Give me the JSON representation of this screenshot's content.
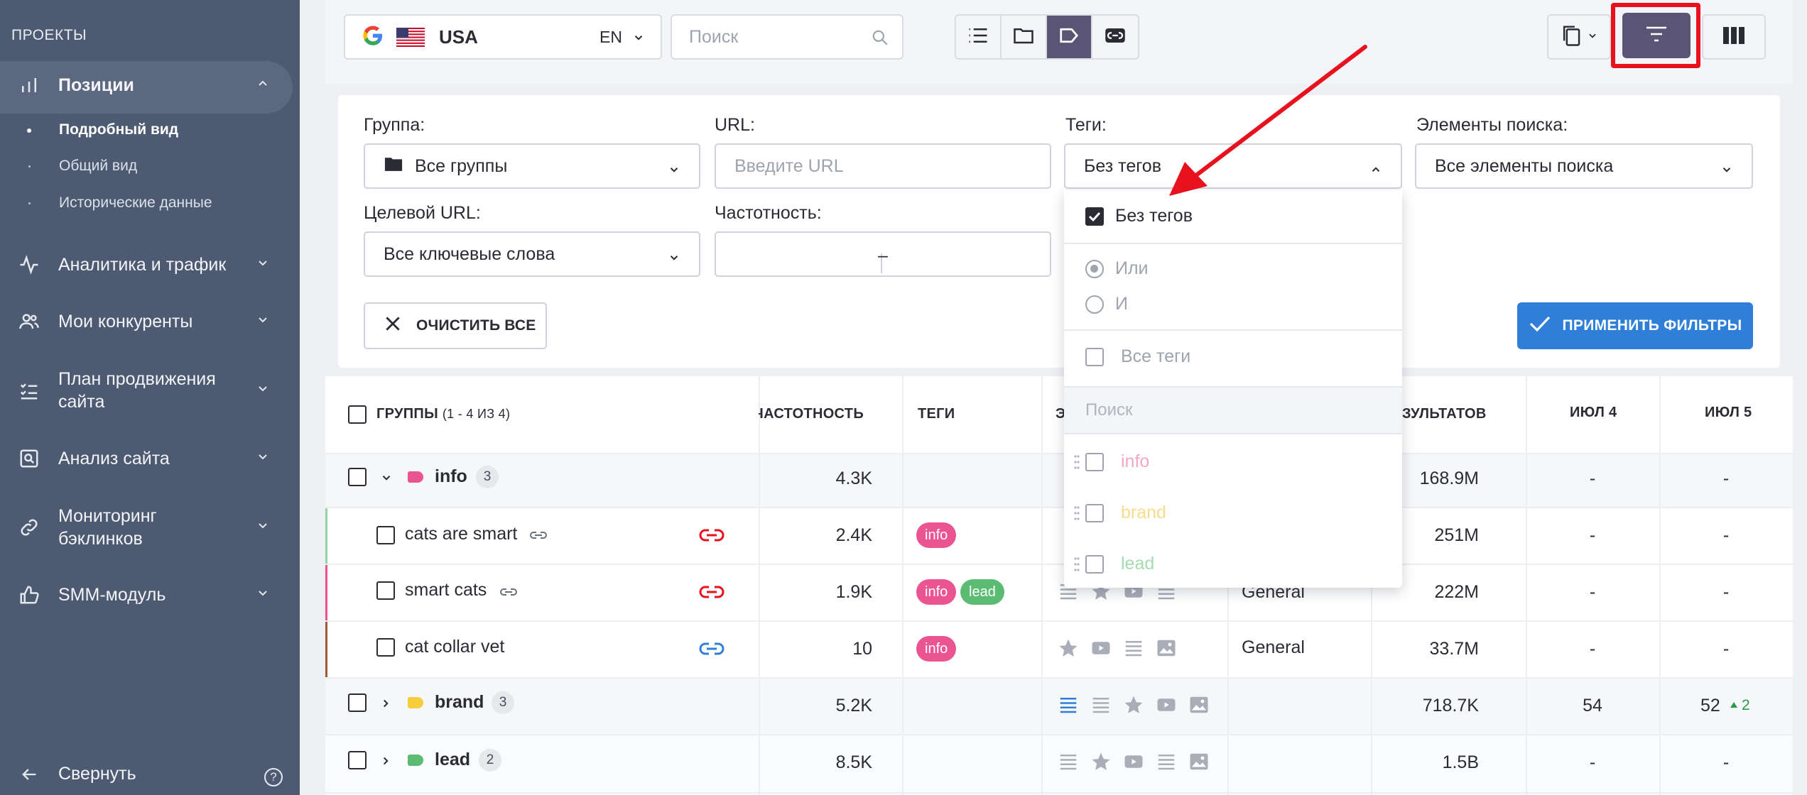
{
  "sidebar": {
    "section_title": "ПРОЕКТЫ",
    "items": [
      {
        "label": "Позиции",
        "icon": "bar-chart-icon"
      },
      {
        "label": "Аналитика и трафик",
        "icon": "activity-icon"
      },
      {
        "label": "Мои конкуренты",
        "icon": "users-icon"
      },
      {
        "label": "План продвижения сайта",
        "icon": "checklist-icon"
      },
      {
        "label": "Анализ сайта",
        "icon": "site-search-icon"
      },
      {
        "label": "Мониторинг бэклинков",
        "icon": "link-icon"
      },
      {
        "label": "SMM-модуль",
        "icon": "thumbs-up-icon"
      }
    ],
    "sub_items": [
      "Подробный вид",
      "Общий вид",
      "Исторические данные"
    ],
    "collapse_label": "Свернуть",
    "help_label": "?"
  },
  "topbar": {
    "engine_icon": "google-icon",
    "country": "USA",
    "language": "EN",
    "search_placeholder": "Поиск"
  },
  "filters": {
    "group_label": "Группа:",
    "group_value": "Все группы",
    "url_label": "URL:",
    "url_placeholder": "Введите URL",
    "tags_label": "Теги:",
    "tags_value": "Без тегов",
    "search_elements_label": "Элементы поиска:",
    "search_elements_value": "Все элементы поиска",
    "target_url_label": "Целевой URL:",
    "target_url_value": "Все ключевые слова",
    "frequency_label": "Частотность:",
    "frequency_dash": "–",
    "clear_label": "ОЧИСТИТЬ ВСЕ",
    "apply_label": "ПРИМЕНИТЬ ФИЛЬТРЫ"
  },
  "tags_dropdown": {
    "no_tags": "Без тегов",
    "or_label": "Или",
    "and_label": "И",
    "all_tags": "Все теги",
    "search_placeholder": "Поиск",
    "tags": [
      {
        "name": "info",
        "color": "#f4a6c4"
      },
      {
        "name": "brand",
        "color": "#f7dc8a"
      },
      {
        "name": "lead",
        "color": "#a6dbb2"
      }
    ]
  },
  "table": {
    "headers": {
      "groups": "ГРУППЫ",
      "groups_count": "(1 - 4 ИЗ 4)",
      "frequency": "ЧАСТОТНОСТЬ",
      "tags": "ТЕГИ",
      "elements_partial": "Э",
      "results": "ЗУЛЬТАТОВ",
      "jul4": "ИЮЛ 4",
      "jul5": "ИЮЛ 5"
    },
    "rows": [
      {
        "type": "group",
        "name": "info",
        "count": "3",
        "freq": "4.3K",
        "results": "168.9M",
        "jul4": "-",
        "jul5": "-",
        "color": "#ea5491"
      },
      {
        "type": "keyword",
        "name": "cats are smart",
        "freq": "2.4K",
        "tags": [
          "info"
        ],
        "results": "251M",
        "jul4": "-",
        "jul5": "-"
      },
      {
        "type": "keyword",
        "name": "smart cats",
        "freq": "1.9K",
        "tags": [
          "info",
          "lead"
        ],
        "target": "General",
        "results": "222M",
        "jul4": "-",
        "jul5": "-"
      },
      {
        "type": "keyword",
        "name": "cat collar vet",
        "freq": "10",
        "tags": [
          "info"
        ],
        "target": "General",
        "results": "33.7M",
        "jul4": "-",
        "jul5": "-"
      },
      {
        "type": "group",
        "name": "brand",
        "count": "3",
        "freq": "5.2K",
        "results": "718.7K",
        "jul4": "54",
        "jul5": "52",
        "jul5_delta": "2",
        "color": "#f6cd3c"
      },
      {
        "type": "group",
        "name": "lead",
        "count": "2",
        "freq": "8.5K",
        "results": "1.5B",
        "jul4": "-",
        "jul5": "-",
        "color": "#5cbb73"
      }
    ]
  },
  "colors": {
    "sidebar": "#4d5a71",
    "accent_purple": "#5a5575",
    "apply_blue": "#2f7fd8",
    "highlight_red": "#e8121f"
  }
}
